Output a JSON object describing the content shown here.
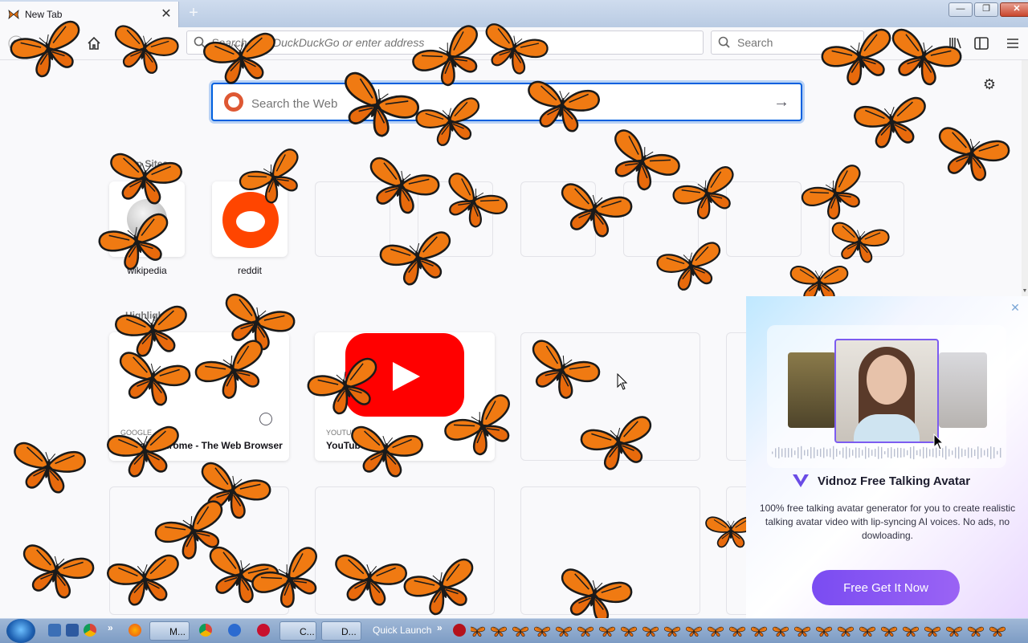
{
  "browser": {
    "tab_title": "New Tab",
    "tab_close": "✕",
    "new_tab": "+",
    "url_placeholder": "Search with DuckDuckGo or enter address",
    "search_placeholder": "Search"
  },
  "newtab": {
    "web_search_placeholder": "Search the Web",
    "top_sites_heading": "Top Sites",
    "highlights_heading": "Highlights",
    "top_sites": [
      {
        "label": "wikipedia"
      },
      {
        "label": "reddit"
      }
    ],
    "highlights": [
      {
        "source": "GOOGLE",
        "title": "Google Chrome - The Web Browser"
      },
      {
        "source": "YOUTUBE",
        "title": "YouTube - YouTube"
      }
    ]
  },
  "ad": {
    "title": "Vidnoz Free Talking Avatar",
    "description": "100% free talking avatar generator for you to create realistic talking avatar video with lip-syncing AI voices. No ads, no dowloading.",
    "button": "Free Get It Now",
    "close": "✕"
  },
  "taskbar": {
    "quick_launch": "Quick Launch",
    "tasks": [
      {
        "label": "M..."
      },
      {
        "label": "C..."
      },
      {
        "label": "D..."
      }
    ]
  },
  "colors": {
    "accent": "#0060df",
    "butterfly": "#f07a12",
    "ad_button": "#8a5af3",
    "youtube": "#ff0000",
    "reddit": "#ff4500"
  }
}
